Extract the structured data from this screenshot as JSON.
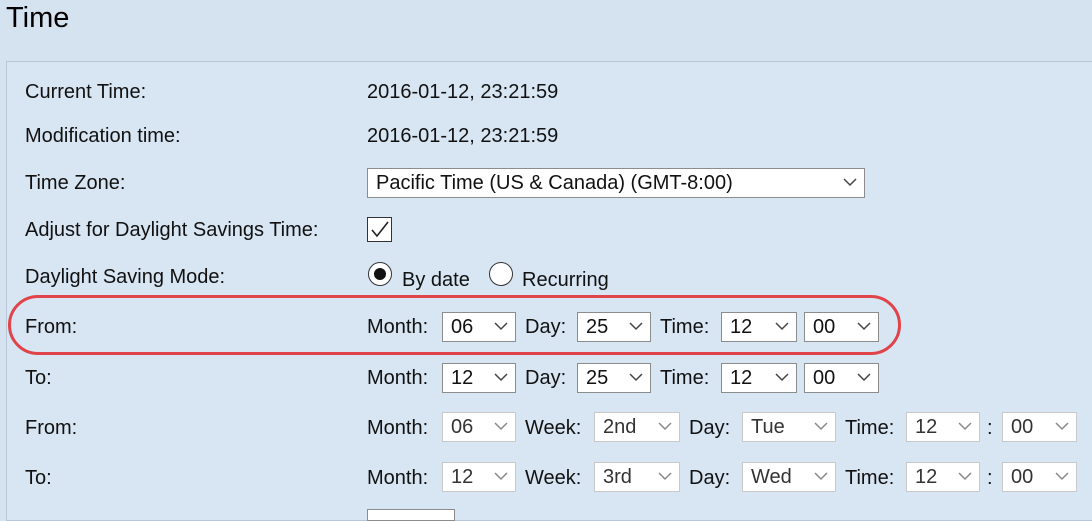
{
  "page": {
    "title": "Time"
  },
  "current_time": {
    "label": "Current Time:",
    "value": "2016-01-12, 23:21:59"
  },
  "modification_time": {
    "label": "Modification time:",
    "value": "2016-01-12, 23:21:59"
  },
  "time_zone": {
    "label": "Time Zone:",
    "value": "Pacific Time (US & Canada) (GMT-8:00)"
  },
  "dst_adjust": {
    "label": "Adjust for Daylight Savings Time:",
    "checked": true
  },
  "dst_mode": {
    "label": "Daylight Saving Mode:",
    "by_date_label": "By date",
    "recurring_label": "Recurring",
    "selected": "By date"
  },
  "by_date_from": {
    "label": "From:",
    "month_label": "Month:",
    "month": "06",
    "day_label": "Day:",
    "day": "25",
    "time_label": "Time:",
    "hour": "12",
    "minute": "00"
  },
  "by_date_to": {
    "label": "To:",
    "month_label": "Month:",
    "month": "12",
    "day_label": "Day:",
    "day": "25",
    "time_label": "Time:",
    "hour": "12",
    "minute": "00"
  },
  "recurring_from": {
    "label": "From:",
    "month_label": "Month:",
    "month": "06",
    "week_label": "Week:",
    "week": "2nd",
    "day_label": "Day:",
    "day": "Tue",
    "time_label": "Time:",
    "hour": "12",
    "separator": ":",
    "minute": "00"
  },
  "recurring_to": {
    "label": "To:",
    "month_label": "Month:",
    "month": "12",
    "week_label": "Week:",
    "week": "3rd",
    "day_label": "Day:",
    "day": "Wed",
    "time_label": "Time:",
    "hour": "12",
    "separator": ":",
    "minute": "00"
  },
  "colors": {
    "highlight": "#e0444a",
    "background": "#d5e2f0"
  }
}
